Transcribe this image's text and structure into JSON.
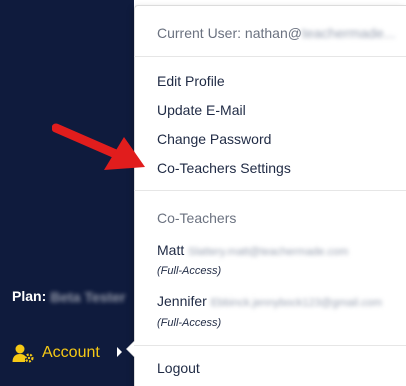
{
  "sidebar": {
    "plan_label": "Plan:",
    "plan_value": "Beta Tester",
    "account_label": "Account",
    "account_icon": "user-cog-icon",
    "colors": {
      "background": "#0f1b3d",
      "accent": "#f6c915"
    }
  },
  "menu": {
    "current_user_prefix": "Current User: nathan@",
    "current_user_hidden": "teachermade...",
    "items": [
      {
        "label": "Edit Profile"
      },
      {
        "label": "Update E-Mail"
      },
      {
        "label": "Change Password"
      },
      {
        "label": "Co-Teachers Settings"
      }
    ],
    "co_teachers_header": "Co-Teachers",
    "co_teachers": [
      {
        "name": "Matt",
        "email": "Slattery.matt@teachermade.com",
        "access": "(Full-Access)"
      },
      {
        "name": "Jennifer",
        "email": "Ebbinck.jennybock123@gmail.com",
        "access": "(Full-Access)"
      }
    ],
    "logout_label": "Logout"
  },
  "annotation": {
    "arrow_color": "#e11d1d"
  }
}
